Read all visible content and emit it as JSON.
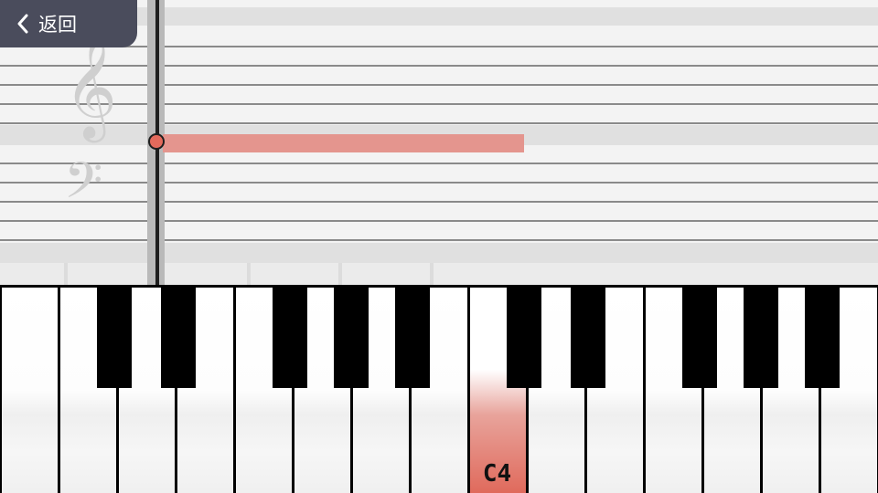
{
  "header": {
    "back_label": "返回"
  },
  "staff": {
    "clefs": [
      "treble-clef",
      "bass-clef"
    ],
    "note": {
      "pitch": "C4"
    }
  },
  "keyboard": {
    "pressed_key": "C4",
    "pressed_label": "C4"
  },
  "colors": {
    "accent": "#e36a5c",
    "note_bar": "#e4958e",
    "back_button_bg": "#4a4c5c"
  }
}
